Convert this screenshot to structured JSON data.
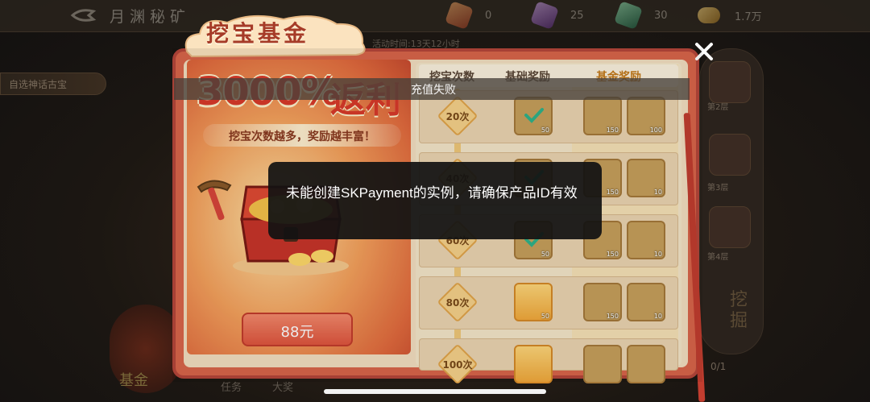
{
  "topbar": {
    "title": "月渊秘矿",
    "resources": [
      {
        "icon": "red-crystal-icon",
        "value": "0",
        "color": "#c0392b"
      },
      {
        "icon": "purple-crystal-icon",
        "value": "25",
        "color": "#8e44ad"
      },
      {
        "icon": "green-crystal-icon",
        "value": "30",
        "color": "#27ae60"
      },
      {
        "icon": "gold-ingot-icon",
        "value": "1.7万",
        "color": "#e0a83a"
      }
    ]
  },
  "side_button": "自选神话古宝",
  "event_time": "活动时间:13天12小时",
  "background": {
    "fund_label": "基金",
    "tabs": [
      "任务",
      "大奖"
    ],
    "rail_labels": [
      "第2层",
      "第3层",
      "第4层"
    ],
    "dig_label": "挖掘",
    "progress": "0/1"
  },
  "panel": {
    "title": "挖宝基金",
    "rate": "3000%",
    "rate_suffix": "返利",
    "slogan": "挖宝次数越多，奖励越丰富！",
    "price": "88元"
  },
  "table": {
    "headers": [
      "挖宝次数",
      "基础奖励",
      "基金奖励"
    ],
    "rows": [
      {
        "count": "20次",
        "base": [
          {
            "icon": "gold-ingot-icon",
            "qty": "50",
            "claimed": true
          }
        ],
        "fund": [
          {
            "icon": "gold-ingot-icon",
            "qty": "150"
          },
          {
            "icon": "pickaxe-icon",
            "qty": "100"
          }
        ]
      },
      {
        "count": "40次",
        "base": [
          {
            "icon": "gold-ingot-icon",
            "qty": "50",
            "claimed": true
          }
        ],
        "fund": [
          {
            "icon": "gold-ingot-icon",
            "qty": "150"
          },
          {
            "icon": "pickaxe-icon",
            "qty": "10"
          }
        ]
      },
      {
        "count": "60次",
        "base": [
          {
            "icon": "gold-ingot-icon",
            "qty": "50",
            "claimed": true
          }
        ],
        "fund": [
          {
            "icon": "gold-ingot-icon",
            "qty": "150"
          },
          {
            "icon": "pickaxe-icon",
            "qty": "10"
          }
        ]
      },
      {
        "count": "80次",
        "base": [
          {
            "icon": "gold-ingot-icon",
            "qty": "50",
            "claimed": false
          }
        ],
        "fund": [
          {
            "icon": "gold-ingot-icon",
            "qty": "150"
          },
          {
            "icon": "pickaxe-icon",
            "qty": "10"
          }
        ]
      },
      {
        "count": "100次",
        "base": [
          {
            "icon": "gold-ingot-icon",
            "qty": "",
            "claimed": false
          }
        ],
        "fund": [
          {
            "icon": "gold-ingot-icon",
            "qty": ""
          },
          {
            "icon": "pickaxe-icon",
            "qty": ""
          }
        ]
      }
    ]
  },
  "overlay": {
    "status": "充值失败",
    "toast": "未能创建SKPayment的实例，请确保产品ID有效"
  }
}
